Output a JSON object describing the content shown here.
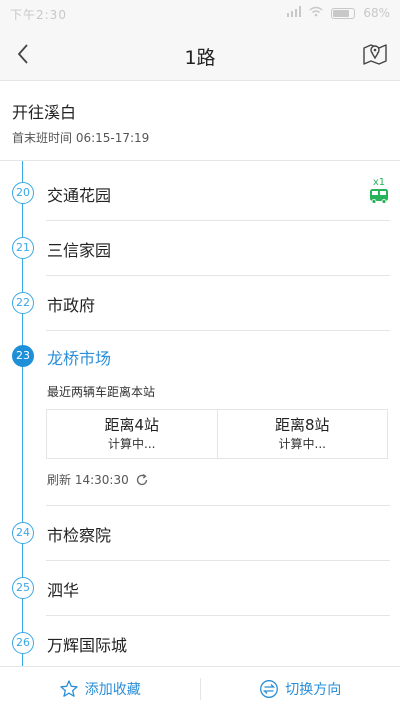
{
  "statusbar": {
    "time": "下午2:30",
    "battery": "68%"
  },
  "header": {
    "title": "1路"
  },
  "route": {
    "direction": "开往溪白",
    "first_last": "首末班时间 06:15-17:19"
  },
  "stops": [
    {
      "num": "20",
      "name": "交通花园",
      "bus_count": "x1"
    },
    {
      "num": "21",
      "name": "三信家园"
    },
    {
      "num": "22",
      "name": "市政府"
    },
    {
      "num": "23",
      "name": "龙桥市场"
    },
    {
      "num": "24",
      "name": "市检察院"
    },
    {
      "num": "25",
      "name": "泗华"
    },
    {
      "num": "26",
      "name": "万辉国际城"
    }
  ],
  "current": {
    "subtitle": "最近两辆车距离本站",
    "buses": [
      {
        "distance": "距离4站",
        "status": "计算中..."
      },
      {
        "distance": "距离8站",
        "status": "计算中..."
      }
    ],
    "refresh": "刷新 14:30:30"
  },
  "bottom": {
    "favorite": "添加收藏",
    "switch": "切换方向"
  },
  "colors": {
    "accent": "#2a8fd8",
    "bus": "#27b35a",
    "line": "#3aa7e6"
  }
}
